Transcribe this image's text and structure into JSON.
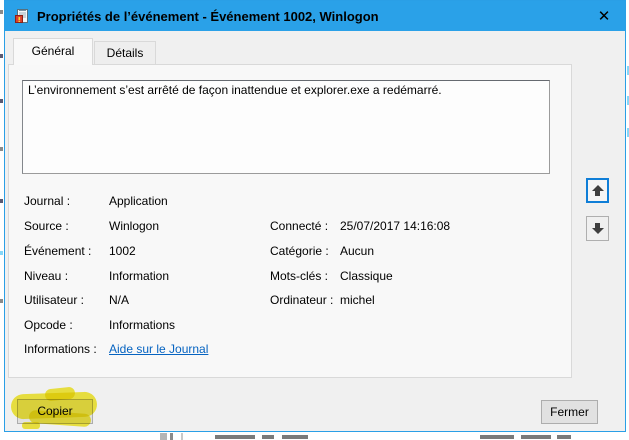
{
  "window": {
    "title": "Propriétés de l’événement - Événement 1002, Winlogon",
    "icons": {
      "close": "✕",
      "titlebar": "event-log-icon",
      "nav_up": "arrow-up",
      "nav_down": "arrow-down"
    },
    "colors": {
      "titlebar": "#2aa1e8",
      "accent_border": "#2a9fe6",
      "focus_ring": "#0f7ed7",
      "highlight_marker": "#f2e60e",
      "link": "#0563c1"
    }
  },
  "tabs": [
    {
      "label": "Général",
      "active": true
    },
    {
      "label": "Détails",
      "active": false
    }
  ],
  "general": {
    "description": "L’environnement s’est arrêté de façon inattendue et explorer.exe a redémarré.",
    "fields_left": [
      {
        "label": "Journal :",
        "value": "Application"
      },
      {
        "label": "Source :",
        "value": "Winlogon"
      },
      {
        "label": "Événement :",
        "value": "1002"
      },
      {
        "label": "Niveau :",
        "value": "Information"
      },
      {
        "label": "Utilisateur :",
        "value": "N/A"
      },
      {
        "label": "Opcode :",
        "value": "Informations"
      },
      {
        "label": "Informations :",
        "value": "Aide sur le Journal",
        "is_link": true
      }
    ],
    "fields_right": [
      {
        "label": "Connecté :",
        "value": "25/07/2017 14:16:08"
      },
      {
        "label": "Catégorie :",
        "value": "Aucun"
      },
      {
        "label": "Mots-clés :",
        "value": "Classique"
      },
      {
        "label": "Ordinateur :",
        "value": "michel"
      }
    ]
  },
  "buttons": {
    "copy": "Copier",
    "close": "Fermer"
  },
  "annotations": {
    "copy_highlight": "yellow-marker-over-copier-button"
  }
}
